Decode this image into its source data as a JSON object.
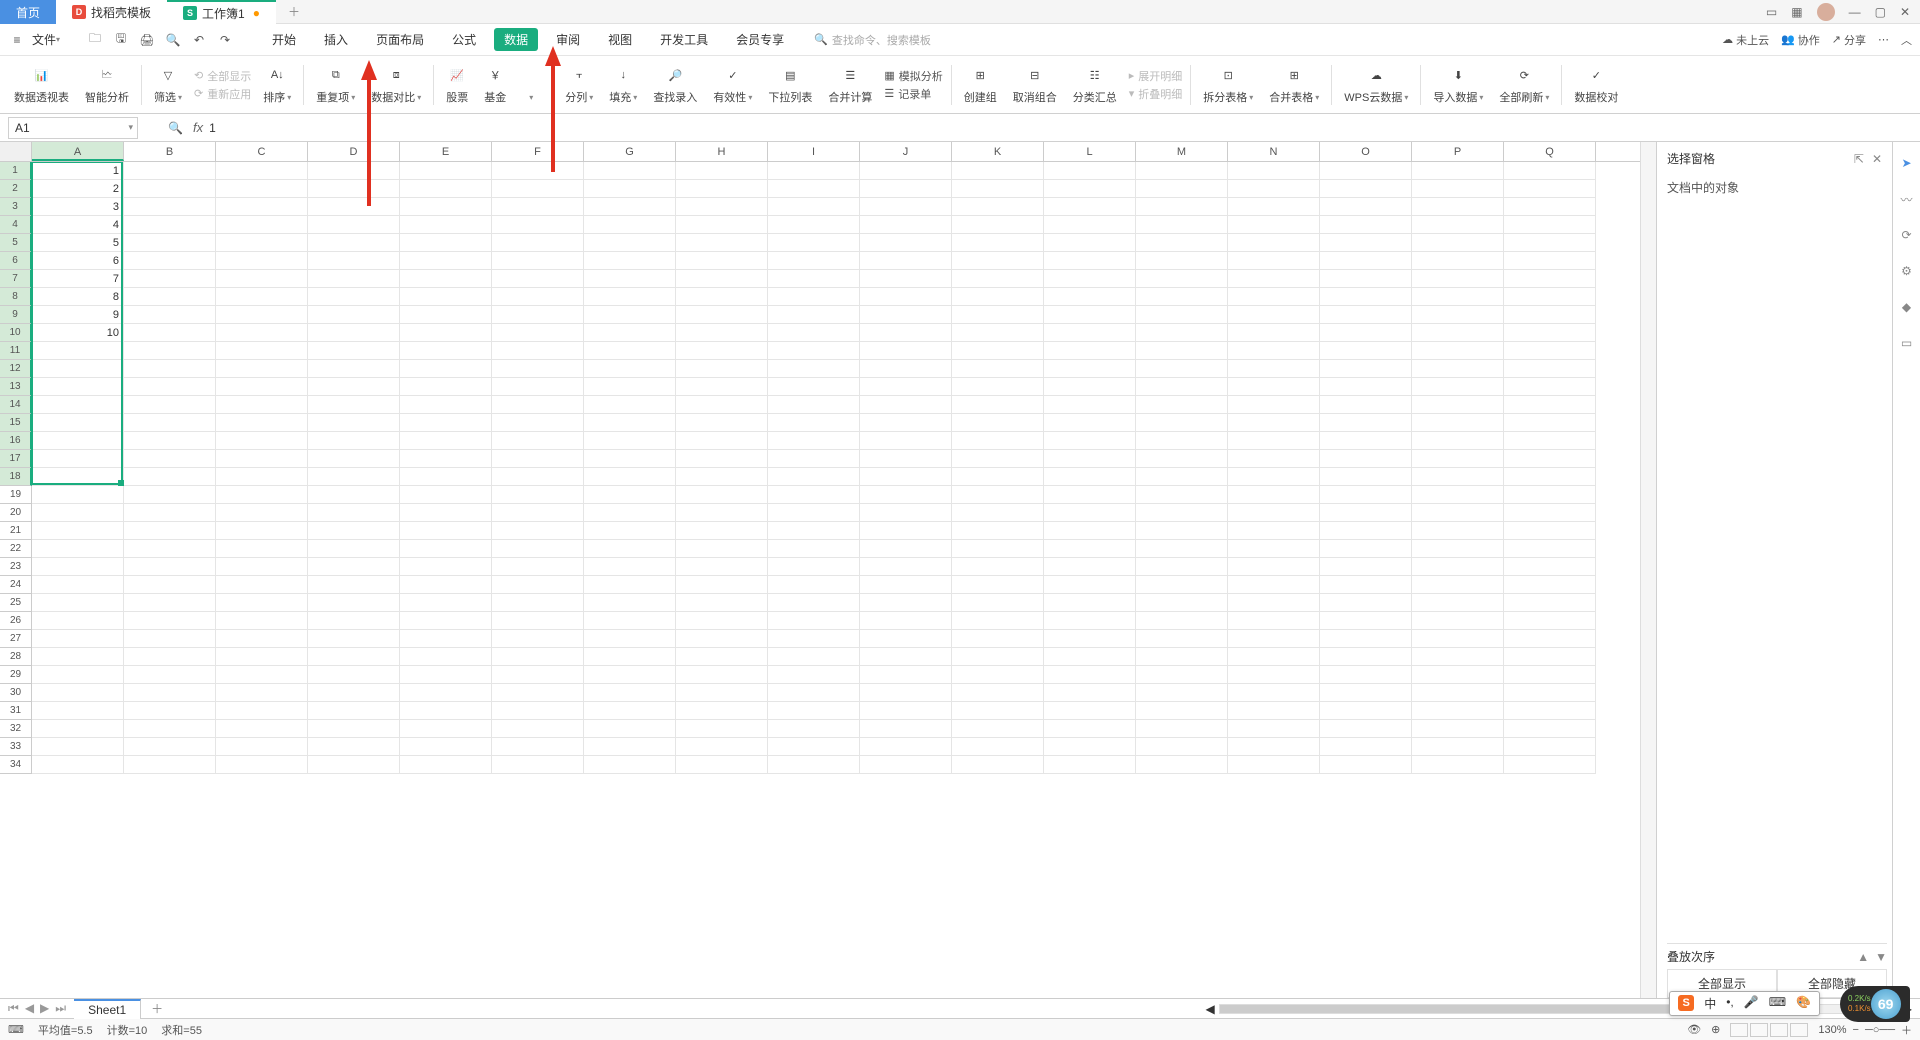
{
  "tabs": {
    "home": "首页",
    "templates": "找稻壳模板",
    "workbook": "工作簿1",
    "mod": "●"
  },
  "menu": {
    "file": "文件",
    "tabs": [
      "开始",
      "插入",
      "页面布局",
      "公式",
      "数据",
      "审阅",
      "视图",
      "开发工具",
      "会员专享"
    ],
    "active": "数据",
    "search_ph": "查找命令、搜索模板",
    "cloud": "未上云",
    "coop": "协作",
    "share": "分享"
  },
  "ribbon": {
    "pivot": "数据透视表",
    "smart": "智能分析",
    "filter": "筛选",
    "showall": "全部显示",
    "reapply": "重新应用",
    "sort": "排序",
    "dup": "重复项",
    "compare": "数据对比",
    "stock": "股票",
    "fund": "基金",
    "split": "分列",
    "fill": "填充",
    "lookup": "查找录入",
    "valid": "有效性",
    "dropdown": "下拉列表",
    "consol": "合并计算",
    "record": "记录单",
    "sim": "模拟分析",
    "group": "创建组",
    "ungroup": "取消组合",
    "subtotal": "分类汇总",
    "expand": "展开明细",
    "collapse": "折叠明细",
    "splittbl": "拆分表格",
    "mergetbl": "合并表格",
    "wpscloud": "WPS云数据",
    "import": "导入数据",
    "refreshall": "全部刷新",
    "validate": "数据校对"
  },
  "namebox": "A1",
  "formula": "1",
  "cols": [
    "A",
    "B",
    "C",
    "D",
    "E",
    "F",
    "G",
    "H",
    "I",
    "J",
    "K",
    "L",
    "M",
    "N",
    "O",
    "P",
    "Q"
  ],
  "rows": 34,
  "selrows": 18,
  "data": {
    "A": [
      1,
      2,
      3,
      4,
      5,
      6,
      7,
      8,
      9,
      10
    ]
  },
  "side": {
    "title": "选择窗格",
    "objects": "文档中的对象",
    "order": "叠放次序",
    "showall": "全部显示",
    "hideall": "全部隐藏"
  },
  "sheet": {
    "name": "Sheet1"
  },
  "status": {
    "avg": "平均值=5.5",
    "count": "计数=10",
    "sum": "求和=55",
    "zoom": "130%"
  },
  "ime": {
    "zh": "中",
    "pin": "ツ"
  },
  "net": {
    "val": "69",
    "up": "0.2K/s",
    "dn": "0.1K/s"
  }
}
